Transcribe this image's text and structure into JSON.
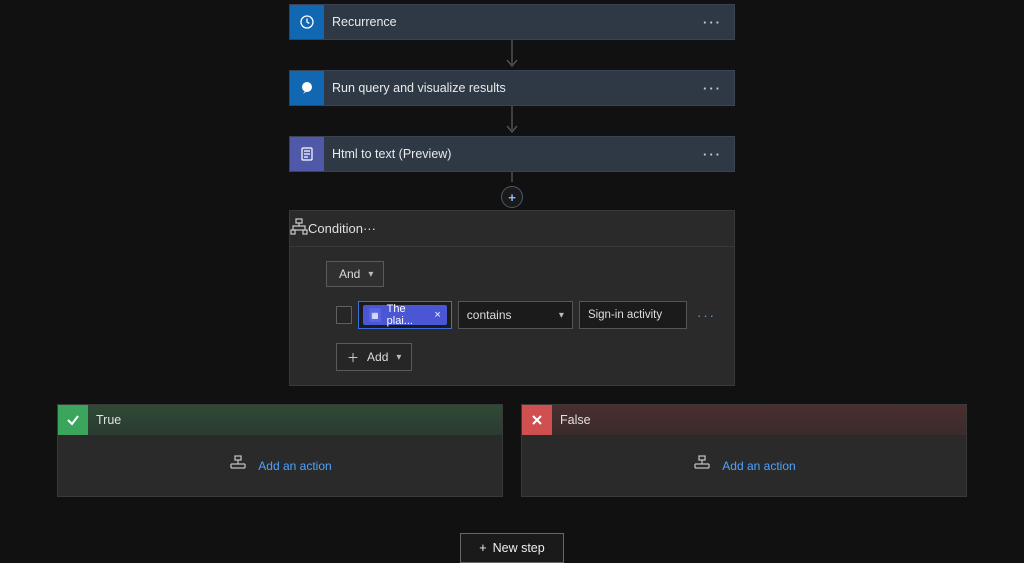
{
  "steps": {
    "recurrence": {
      "label": "Recurrence"
    },
    "run_query": {
      "label": "Run query and visualize results"
    },
    "html_text": {
      "label": "Html to text (Preview)"
    }
  },
  "condition": {
    "label": "Condition",
    "group_operator": "And",
    "rule": {
      "token_label": "The plai...",
      "operator": "contains",
      "value": "Sign-in activity"
    },
    "add_label": "Add"
  },
  "branches": {
    "true": {
      "label": "True",
      "add_action_label": "Add an action"
    },
    "false": {
      "label": "False",
      "add_action_label": "Add an action"
    }
  },
  "new_step_label": "New step",
  "colors": {
    "icon_blue": "#1267b3",
    "icon_purple": "#5058a8",
    "true_green": "#3ba55d",
    "false_red": "#d05050",
    "link_blue": "#4da3ff"
  }
}
